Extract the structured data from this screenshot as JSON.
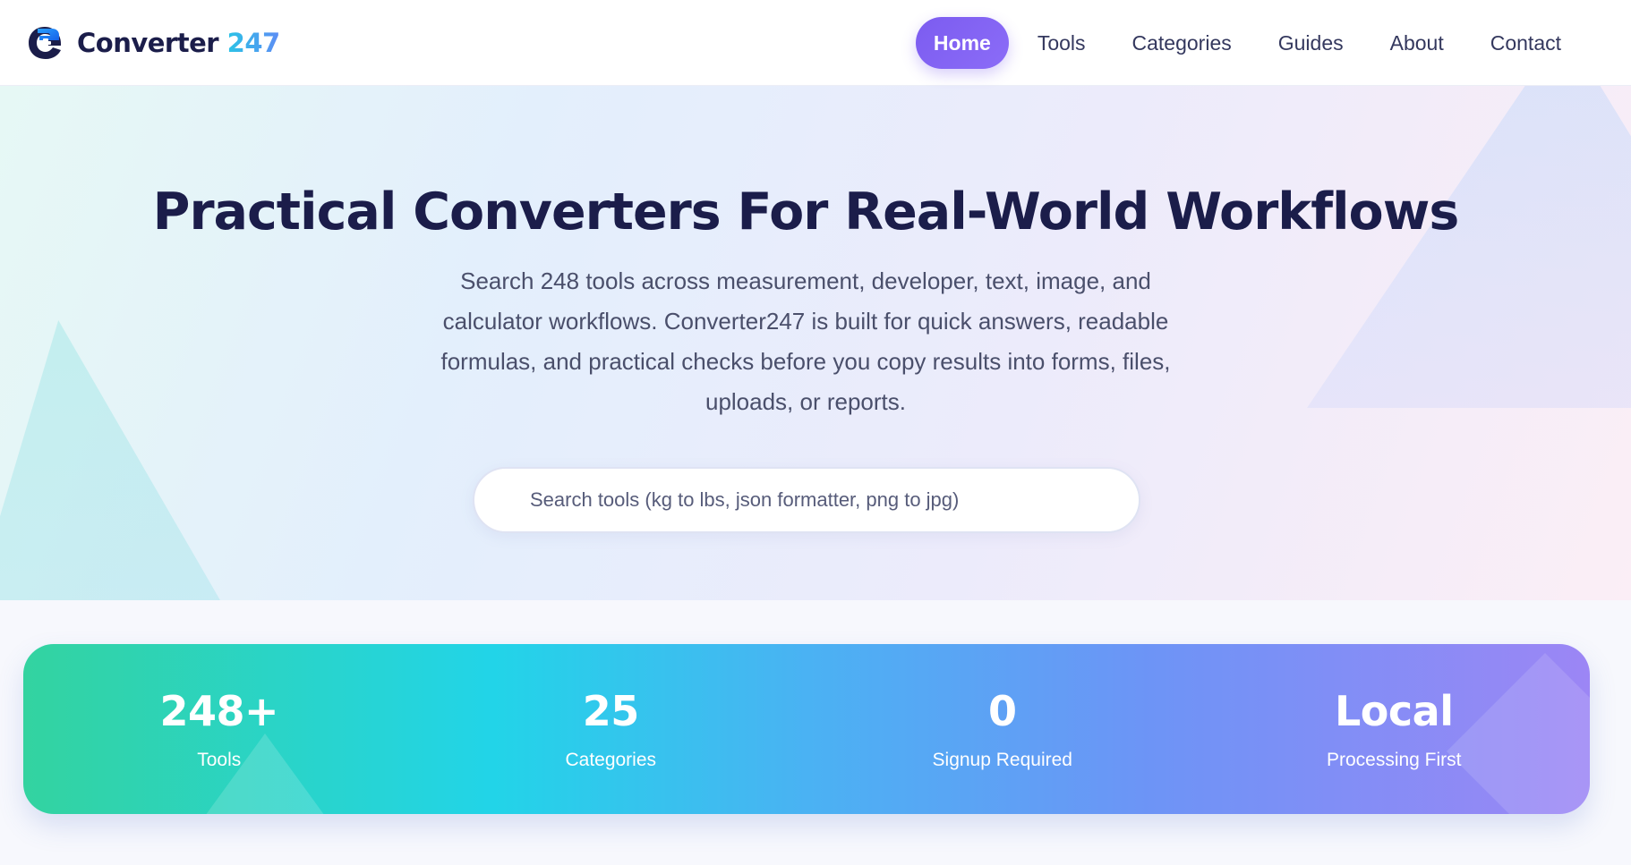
{
  "brand": {
    "name_prefix": "Converter ",
    "name_accent": "247"
  },
  "nav": {
    "items": [
      {
        "label": "Home",
        "active": true
      },
      {
        "label": "Tools",
        "active": false
      },
      {
        "label": "Categories",
        "active": false
      },
      {
        "label": "Guides",
        "active": false
      },
      {
        "label": "About",
        "active": false
      },
      {
        "label": "Contact",
        "active": false
      }
    ]
  },
  "hero": {
    "title": "Practical Converters For Real-World Workflows",
    "description": "Search 248 tools across measurement, developer, text, image, and calculator workflows. Converter247 is built for quick answers, readable formulas, and practical checks before you copy results into forms, files, uploads, or reports.",
    "search": {
      "placeholder": "Search tools (kg to lbs, json formatter, png to jpg)",
      "value": ""
    }
  },
  "stats": [
    {
      "value": "248+",
      "label": "Tools"
    },
    {
      "value": "25",
      "label": "Categories"
    },
    {
      "value": "0",
      "label": "Signup Required"
    },
    {
      "value": "Local",
      "label": "Processing First"
    }
  ],
  "colors": {
    "primary_text": "#1b1d4a",
    "nav_active_bg": "#7c5cf0",
    "accent_cyan": "#2bc3e6",
    "stats_gradient_start": "#33d3a0",
    "stats_gradient_end": "#9c86f5"
  },
  "icons": {
    "logo": "converter-logo-icon",
    "search": "search-icon"
  }
}
